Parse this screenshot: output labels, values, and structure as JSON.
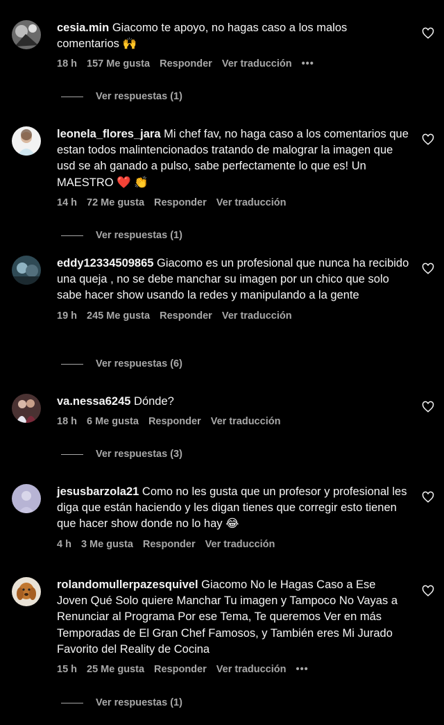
{
  "colors": {
    "background": "#000000",
    "text": "#f5f5f5",
    "secondary": "#a8a8a8",
    "heart_emoji": "#e0245e"
  },
  "comments": [
    {
      "username": "cesia.min",
      "text": "Giacomo te apoyo, no hagas caso a los malos comentarios 🙌",
      "time": "18 h",
      "likes": "157 Me gusta",
      "reply_label": "Responder",
      "translate_label": "Ver traducción",
      "more": "•••",
      "replies_label": "Ver respuestas (1)",
      "avatar_icon": "avatar-dark-photo"
    },
    {
      "username": "leonela_flores_jara",
      "text": "Mi chef fav, no haga caso a los comentarios que estan todos malintencionados tratando de malograr la imagen que usd se ah ganado a pulso, sabe perfectamente lo que es! Un MAESTRO ❤️ 👏",
      "time": "14 h",
      "likes": "72 Me gusta",
      "reply_label": "Responder",
      "translate_label": "Ver traducción",
      "more": "",
      "replies_label": "Ver respuestas (1)",
      "avatar_icon": "avatar-light-photo"
    },
    {
      "username": "eddy12334509865",
      "text": "Giacomo es un profesional que nunca ha recibido una queja , no se debe manchar su imagen por un chico que solo sabe hacer show usando la redes y manipulando a la gente",
      "time": "19 h",
      "likes": "245 Me gusta",
      "reply_label": "Responder",
      "translate_label": "Ver traducción",
      "more": "",
      "replies_label": "Ver respuestas (6)",
      "avatar_icon": "avatar-blue-photo"
    },
    {
      "username": "va.nessa6245",
      "text": "Dónde?",
      "time": "18 h",
      "likes": "6 Me gusta",
      "reply_label": "Responder",
      "translate_label": "Ver traducción",
      "more": "",
      "replies_label": "Ver respuestas (3)",
      "avatar_icon": "avatar-couple-photo"
    },
    {
      "username": "jesusbarzola21",
      "text": "Como no les gusta que un profesor y profesional les diga que están haciendo y les digan tienes que corregir esto tienen que hacer show donde no lo hay 😂",
      "time": "4 h",
      "likes": "3 Me gusta",
      "reply_label": "Responder",
      "translate_label": "Ver traducción",
      "more": "",
      "replies_label": "",
      "avatar_icon": "avatar-lavender-photo"
    },
    {
      "username": "rolandomullerpazesquivel",
      "text": "Giacomo No le Hagas Caso a Ese Joven Qué Solo quiere Manchar Tu imagen y Tampoco No Vayas a Renunciar al Programa Por ese Tema, Te queremos Ver en más Temporadas de El Gran Chef Famosos, y También eres Mi Jurado Favorito del Reality de Cocina",
      "time": "15 h",
      "likes": "25 Me gusta",
      "reply_label": "Responder",
      "translate_label": "Ver traducción",
      "more": "•••",
      "replies_label": "Ver respuestas (1)",
      "avatar_icon": "avatar-dog-photo"
    }
  ]
}
